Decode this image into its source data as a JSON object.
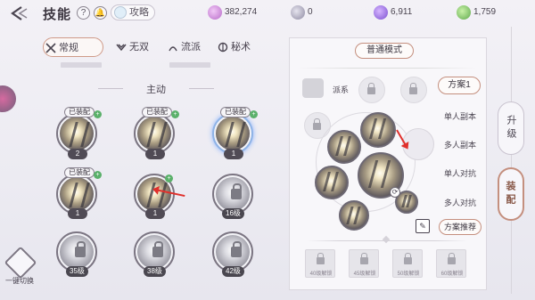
{
  "header": {
    "title": "技能",
    "help_label": "?",
    "guide_label": "攻略",
    "currencies": [
      {
        "name": "pink-crystal",
        "value": "382,274"
      },
      {
        "name": "silver-coin",
        "value": "0"
      },
      {
        "name": "purple-gem",
        "value": "6,911"
      },
      {
        "name": "green-gem",
        "value": "1,759"
      }
    ]
  },
  "tabs": [
    {
      "label": "常规",
      "active": true
    },
    {
      "label": "无双",
      "active": false
    },
    {
      "label": "流派",
      "active": false
    },
    {
      "label": "秘术",
      "active": false
    }
  ],
  "section_title": "主动",
  "skills": [
    {
      "tag": "已装配",
      "level": "2",
      "locked": false
    },
    {
      "tag": "已装配",
      "level": "1",
      "locked": false
    },
    {
      "tag": "已装配",
      "level": "1",
      "locked": false,
      "highlighted": true
    },
    {
      "tag": "已装配",
      "level": "1",
      "locked": false
    },
    {
      "tag": "",
      "level": "1",
      "locked": false
    },
    {
      "tag": "",
      "level": "16级",
      "locked": true
    },
    {
      "tag": "",
      "level": "35级",
      "locked": true
    },
    {
      "tag": "",
      "level": "38级",
      "locked": true
    },
    {
      "tag": "",
      "level": "42级",
      "locked": true
    }
  ],
  "left_bottom": {
    "switch_label": "一键切换"
  },
  "panel": {
    "mode_label": "普通模式",
    "school_label": "派系",
    "plans": {
      "active": "方案1",
      "items": [
        "单人副本",
        "多人副本",
        "单人对抗",
        "多人对抗"
      ]
    },
    "recommend_label": "方案推荐",
    "unlock_slots": [
      "40级解锁",
      "45级解锁",
      "50级解锁",
      "60级解锁"
    ]
  },
  "side_tabs": [
    {
      "label": "升级",
      "active": false
    },
    {
      "label": "装配",
      "active": true
    }
  ],
  "colors": {
    "accent": "#c48f7e",
    "annotation_arrow": "#e0302c",
    "plus_badge": "#5ab06a"
  }
}
